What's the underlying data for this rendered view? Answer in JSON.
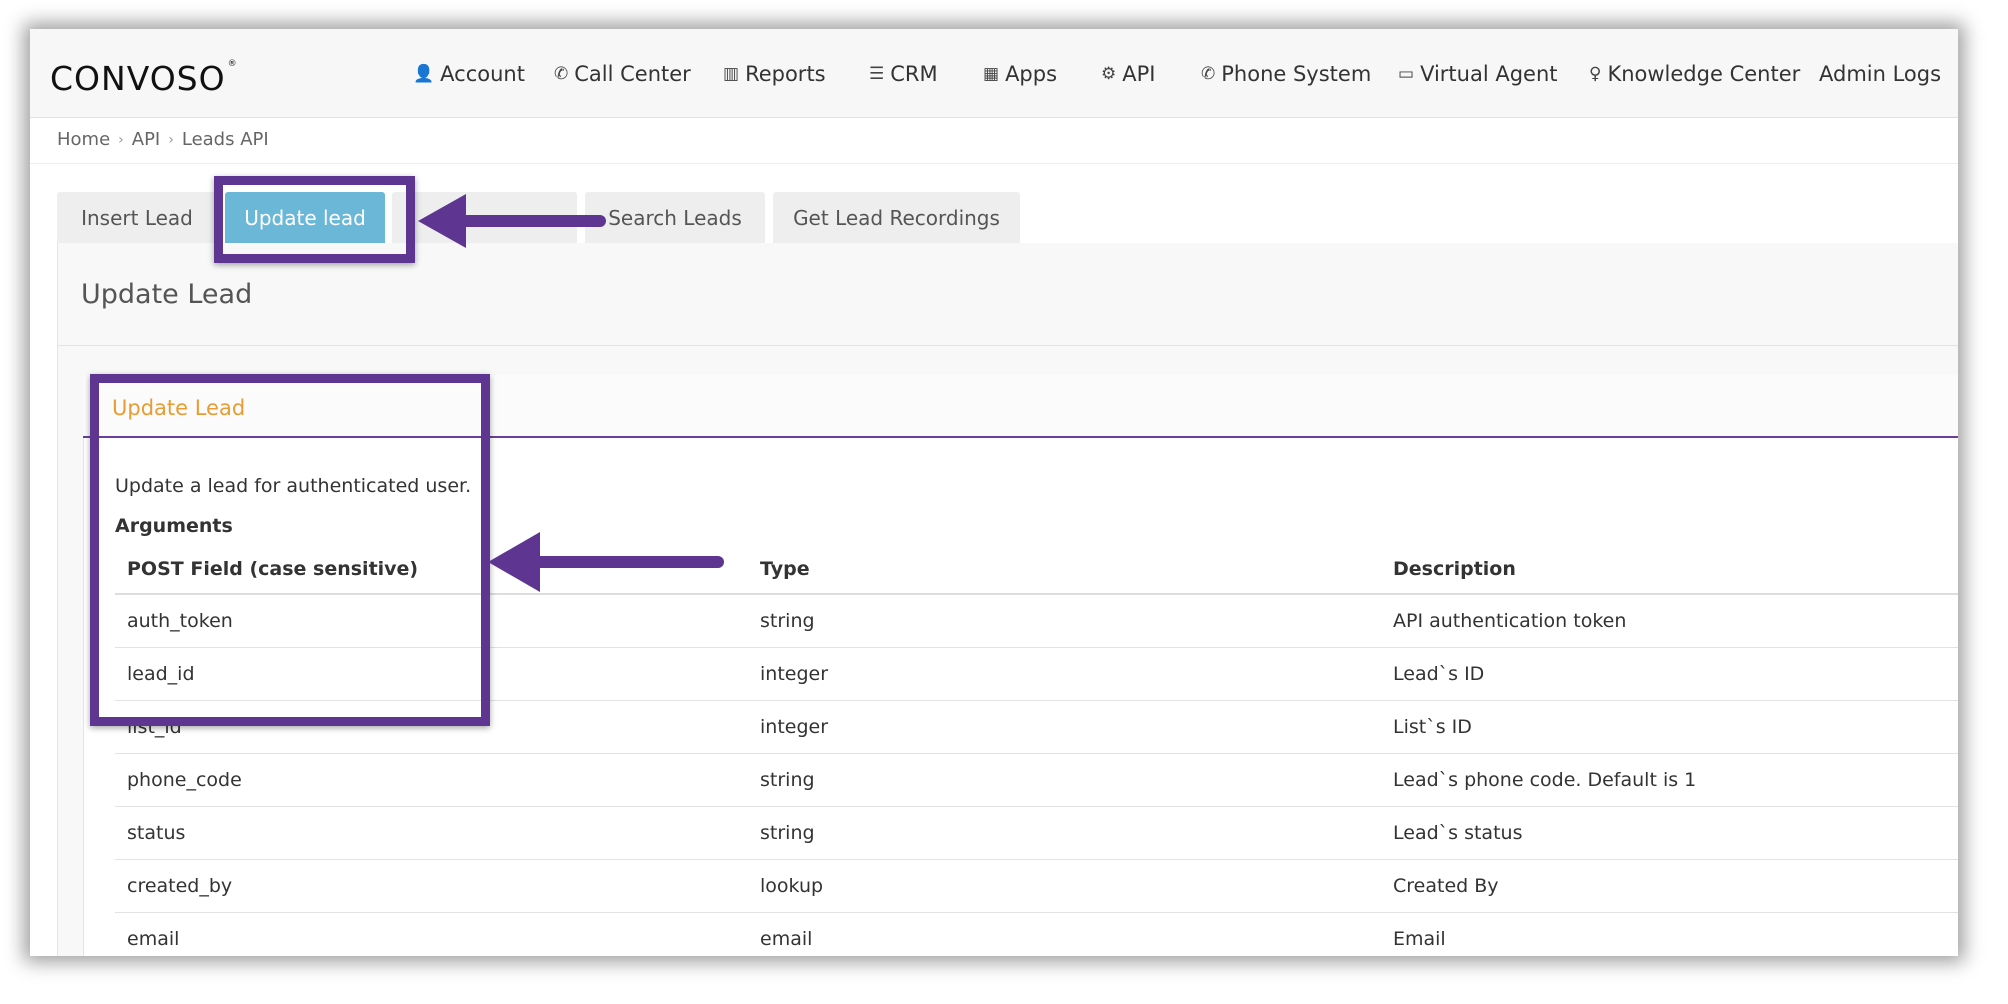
{
  "logo": {
    "text": "CONVOSO",
    "mark": "®"
  },
  "nav": [
    {
      "label": "Account",
      "icon": "user-icon",
      "glyph": "👤"
    },
    {
      "label": "Call Center",
      "icon": "phone-icon",
      "glyph": "✆"
    },
    {
      "label": "Reports",
      "icon": "bar-chart-icon",
      "glyph": "▥"
    },
    {
      "label": "CRM",
      "icon": "list-icon",
      "glyph": "☰"
    },
    {
      "label": "Apps",
      "icon": "grid-icon",
      "glyph": "▦"
    },
    {
      "label": "API",
      "icon": "gear-icon",
      "glyph": "⚙"
    },
    {
      "label": "Phone System",
      "icon": "phone-icon",
      "glyph": "✆"
    },
    {
      "label": "Virtual Agent",
      "icon": "monitor-icon",
      "glyph": "▭"
    },
    {
      "label": "Knowledge Center",
      "icon": "lightbulb-icon",
      "glyph": "♀"
    },
    {
      "label": "Admin Logs",
      "icon": "",
      "glyph": ""
    }
  ],
  "breadcrumb": [
    "Home",
    "API",
    "Leads API"
  ],
  "tabs": [
    {
      "label": "Insert Lead",
      "active": false
    },
    {
      "label": "Update lead",
      "active": true
    },
    {
      "label": "Search Leads",
      "active": false
    },
    {
      "label": "Get Lead Recordings",
      "active": false
    }
  ],
  "panel_title": "Update Lead",
  "card_title": "Update Lead",
  "description": "Update a lead for authenticated user.",
  "arguments_label": "Arguments",
  "table": {
    "headers": [
      "POST Field (case sensitive)",
      "Type",
      "Description"
    ],
    "rows": [
      [
        "auth_token",
        "string",
        "API authentication token"
      ],
      [
        "lead_id",
        "integer",
        "Lead`s ID"
      ],
      [
        "list_id",
        "integer",
        "List`s ID"
      ],
      [
        "phone_code",
        "string",
        "Lead`s phone code. Default is 1"
      ],
      [
        "status",
        "string",
        "Lead`s status"
      ],
      [
        "created_by",
        "lookup",
        "Created By"
      ],
      [
        "email",
        "email",
        "Email"
      ]
    ]
  },
  "colors": {
    "accent_tab": "#6bb7d8",
    "annotation": "#5e3590",
    "card_title": "#e89c33",
    "card_rule": "#6b3f99"
  }
}
